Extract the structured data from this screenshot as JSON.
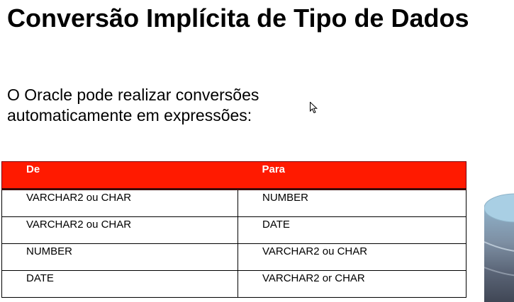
{
  "slide": {
    "title": "Conversão Implícita de Tipo de Dados",
    "body_line1": "O Oracle pode realizar conversões",
    "body_line2": "automaticamente em expressões:"
  },
  "table": {
    "headers": [
      "De",
      "Para"
    ],
    "rows": [
      [
        "VARCHAR2 ou CHAR",
        "NUMBER"
      ],
      [
        "VARCHAR2 ou CHAR",
        "DATE"
      ],
      [
        "NUMBER",
        "VARCHAR2 ou CHAR"
      ],
      [
        "DATE",
        "VARCHAR2 or CHAR"
      ]
    ]
  },
  "colors": {
    "header_bg": "#ff1a00",
    "header_text": "#ffffff",
    "cylinder_top": "#a9cfe4"
  },
  "icons": [
    "mouse-cursor-icon",
    "database-cylinder-icon"
  ]
}
